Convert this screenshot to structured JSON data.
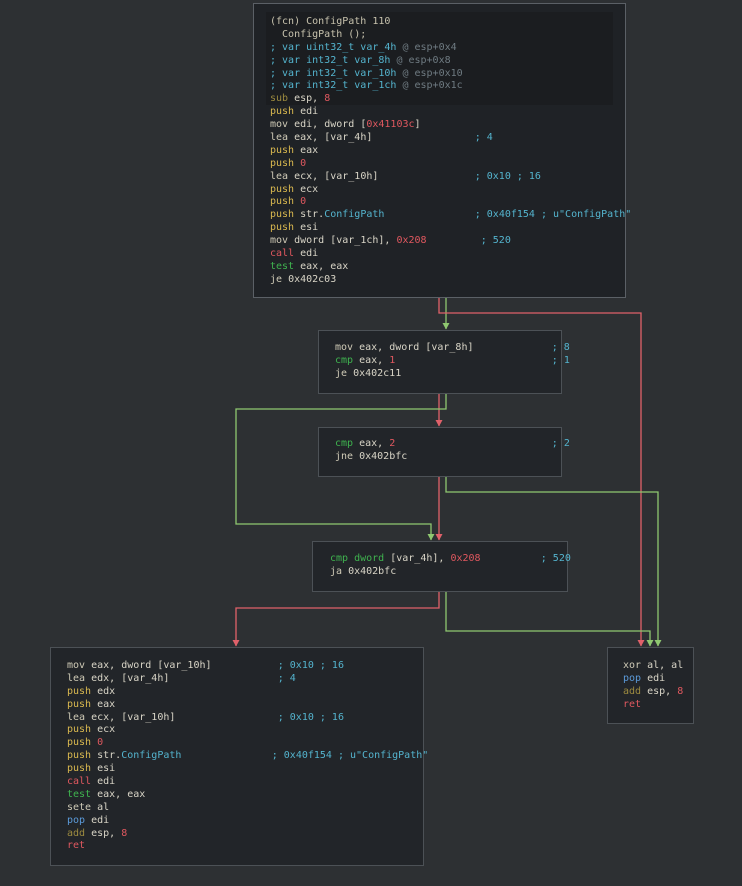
{
  "colors": {
    "background": "#2d3033",
    "block_bg": "#222529",
    "edge_true": "#8fc870",
    "edge_false": "#e0616a"
  },
  "blocks": [
    {
      "id": "entry",
      "lines": [
        [
          [
            "c-hdr",
            "(fcn) ConfigPath 110"
          ]
        ],
        [
          [
            "c-hdr",
            "  ConfigPath ();"
          ]
        ],
        [
          [
            "c-cmt",
            "; var uint32_t var_4h "
          ],
          [
            "c-addr",
            "@ esp+0x4"
          ]
        ],
        [
          [
            "c-cmt",
            "; var int32_t var_8h "
          ],
          [
            "c-addr",
            "@ esp+0x8"
          ]
        ],
        [
          [
            "c-cmt",
            "; var int32_t var_10h "
          ],
          [
            "c-addr",
            "@ esp+0x10"
          ]
        ],
        [
          [
            "c-cmt",
            "; var int32_t var_1ch "
          ],
          [
            "c-addr",
            "@ esp+0x1c"
          ]
        ],
        [
          [
            "c-sub",
            "sub "
          ],
          [
            "c-op",
            "esp, "
          ],
          [
            "c-imm",
            "8"
          ]
        ],
        [
          [
            "c-push",
            "push "
          ],
          [
            "c-op",
            "edi"
          ]
        ],
        [
          [
            "c-mnem",
            "mov "
          ],
          [
            "c-op",
            "edi, dword ["
          ],
          [
            "c-mem",
            "0x41103c"
          ],
          [
            "c-op",
            "]"
          ]
        ],
        [
          [
            "c-mnem",
            "lea "
          ],
          [
            "c-op",
            "eax, [var_4h]                 "
          ],
          [
            "c-cmt",
            "; 4"
          ]
        ],
        [
          [
            "c-push",
            "push "
          ],
          [
            "c-op",
            "eax"
          ]
        ],
        [
          [
            "c-push",
            "push "
          ],
          [
            "c-imm",
            "0"
          ]
        ],
        [
          [
            "c-mnem",
            "lea "
          ],
          [
            "c-op",
            "ecx, [var_10h]                "
          ],
          [
            "c-cmt",
            "; 0x10 ; 16"
          ]
        ],
        [
          [
            "c-push",
            "push "
          ],
          [
            "c-op",
            "ecx"
          ]
        ],
        [
          [
            "c-push",
            "push "
          ],
          [
            "c-imm",
            "0"
          ]
        ],
        [
          [
            "c-push",
            "push "
          ],
          [
            "c-op",
            "str."
          ],
          [
            "c-sym",
            "ConfigPath"
          ],
          [
            "c-op",
            "               "
          ],
          [
            "c-cmt",
            "; 0x40f154 ; u\"ConfigPath\""
          ]
        ],
        [
          [
            "c-push",
            "push "
          ],
          [
            "c-op",
            "esi"
          ]
        ],
        [
          [
            "c-mnem",
            "mov "
          ],
          [
            "c-op",
            "dword [var_1ch], "
          ],
          [
            "c-imm",
            "0x208"
          ],
          [
            "c-op",
            "         "
          ],
          [
            "c-cmt",
            "; 520"
          ]
        ],
        [
          [
            "c-call",
            "call "
          ],
          [
            "c-op",
            "edi"
          ]
        ],
        [
          [
            "c-test",
            "test "
          ],
          [
            "c-op",
            "eax, eax"
          ]
        ],
        [
          [
            "c-mnem",
            "je "
          ],
          [
            "c-op",
            "0x402c03"
          ]
        ]
      ]
    },
    {
      "id": "b1",
      "lines": [
        [
          [
            "c-mnem",
            "mov "
          ],
          [
            "c-op",
            "eax, dword [var_8h]             "
          ],
          [
            "c-cmt",
            "; 8"
          ]
        ],
        [
          [
            "c-test",
            "cmp "
          ],
          [
            "c-op",
            "eax, "
          ],
          [
            "c-imm",
            "1"
          ],
          [
            "c-op",
            "                          "
          ],
          [
            "c-cmt",
            "; 1"
          ]
        ],
        [
          [
            "c-mnem",
            "je "
          ],
          [
            "c-op",
            "0x402c11"
          ]
        ]
      ]
    },
    {
      "id": "b2",
      "lines": [
        [
          [
            "c-test",
            "cmp "
          ],
          [
            "c-op",
            "eax, "
          ],
          [
            "c-imm",
            "2"
          ],
          [
            "c-op",
            "                          "
          ],
          [
            "c-cmt",
            "; 2"
          ]
        ],
        [
          [
            "c-mnem",
            "jne "
          ],
          [
            "c-op",
            "0x402bfc"
          ]
        ]
      ]
    },
    {
      "id": "b3",
      "lines": [
        [
          [
            "c-test",
            "cmp "
          ],
          [
            "c-test",
            "dword "
          ],
          [
            "c-op",
            "[var_4h], "
          ],
          [
            "c-imm",
            "0x208"
          ],
          [
            "c-op",
            "          "
          ],
          [
            "c-cmt",
            "; 520"
          ]
        ],
        [
          [
            "c-mnem",
            "ja "
          ],
          [
            "c-op",
            "0x402bfc"
          ]
        ]
      ]
    },
    {
      "id": "b4",
      "lines": [
        [
          [
            "c-mnem",
            "mov "
          ],
          [
            "c-op",
            "eax, dword [var_10h]           "
          ],
          [
            "c-cmt",
            "; 0x10 ; 16"
          ]
        ],
        [
          [
            "c-mnem",
            "lea "
          ],
          [
            "c-op",
            "edx, [var_4h]                  "
          ],
          [
            "c-cmt",
            "; 4"
          ]
        ],
        [
          [
            "c-push",
            "push "
          ],
          [
            "c-op",
            "edx"
          ]
        ],
        [
          [
            "c-push",
            "push "
          ],
          [
            "c-op",
            "eax"
          ]
        ],
        [
          [
            "c-mnem",
            "lea "
          ],
          [
            "c-op",
            "ecx, [var_10h]                 "
          ],
          [
            "c-cmt",
            "; 0x10 ; 16"
          ]
        ],
        [
          [
            "c-push",
            "push "
          ],
          [
            "c-op",
            "ecx"
          ]
        ],
        [
          [
            "c-push",
            "push "
          ],
          [
            "c-imm",
            "0"
          ]
        ],
        [
          [
            "c-push",
            "push "
          ],
          [
            "c-op",
            "str."
          ],
          [
            "c-sym",
            "ConfigPath"
          ],
          [
            "c-op",
            "               "
          ],
          [
            "c-cmt",
            "; 0x40f154 ; u\"ConfigPath\""
          ]
        ],
        [
          [
            "c-push",
            "push "
          ],
          [
            "c-op",
            "esi"
          ]
        ],
        [
          [
            "c-call",
            "call "
          ],
          [
            "c-op",
            "edi"
          ]
        ],
        [
          [
            "c-test",
            "test "
          ],
          [
            "c-op",
            "eax, eax"
          ]
        ],
        [
          [
            "c-mnem",
            "sete "
          ],
          [
            "c-op",
            "al"
          ]
        ],
        [
          [
            "c-pop",
            "pop "
          ],
          [
            "c-op",
            "edi"
          ]
        ],
        [
          [
            "c-sub",
            "add "
          ],
          [
            "c-op",
            "esp, "
          ],
          [
            "c-imm",
            "8"
          ]
        ],
        [
          [
            "c-ret",
            "ret"
          ]
        ]
      ]
    },
    {
      "id": "b5",
      "lines": [
        [
          [
            "c-xor",
            "xor "
          ],
          [
            "c-op",
            "al, al"
          ]
        ],
        [
          [
            "c-pop",
            "pop "
          ],
          [
            "c-op",
            "edi"
          ]
        ],
        [
          [
            "c-sub",
            "add "
          ],
          [
            "c-op",
            "esp, "
          ],
          [
            "c-imm",
            "8"
          ]
        ],
        [
          [
            "c-ret",
            "ret"
          ]
        ]
      ]
    }
  ]
}
